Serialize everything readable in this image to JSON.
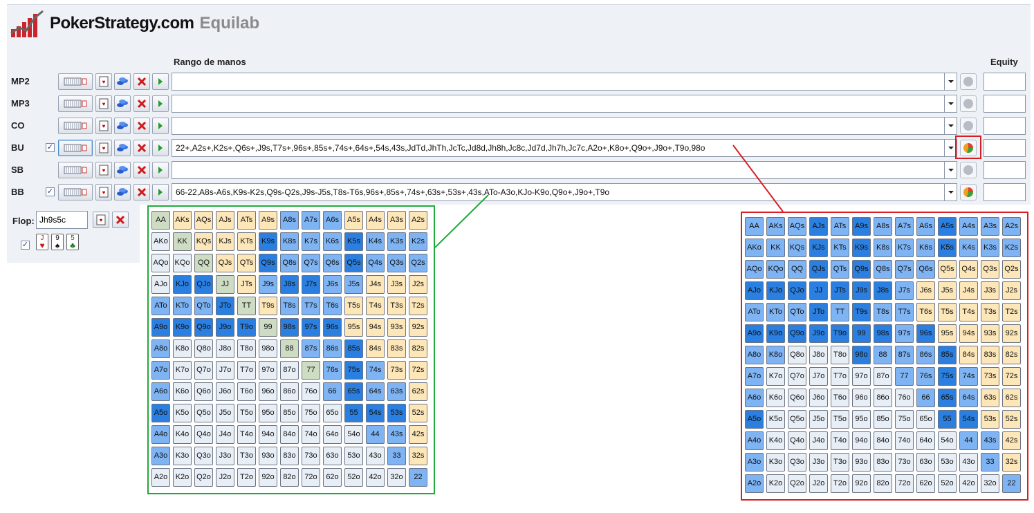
{
  "app": {
    "brand": "PokerStrategy.com",
    "product": "Equilab"
  },
  "headers": {
    "range": "Rango de manos",
    "equity": "Equity"
  },
  "rows": [
    {
      "label": "MP2",
      "checked": false,
      "range": "",
      "status": "idle"
    },
    {
      "label": "MP3",
      "checked": false,
      "range": "",
      "status": "idle"
    },
    {
      "label": "CO",
      "checked": false,
      "range": "",
      "status": "idle"
    },
    {
      "label": "BU",
      "checked": true,
      "range": "22+,A2s+,K2s+,Q6s+,J9s,T7s+,96s+,85s+,74s+,64s+,54s,43s,JdTd,JhTh,JcTc,Jd8d,Jh8h,Jc8c,Jd7d,Jh7h,Jc7c,A2o+,K8o+,Q9o+,J9o+,T9o,98o",
      "status": "active"
    },
    {
      "label": "SB",
      "checked": false,
      "range": "",
      "status": "idle"
    },
    {
      "label": "BB",
      "checked": true,
      "range": "66-22,A8s-A6s,K9s-K2s,Q9s-Q2s,J9s-J5s,T8s-T6s,96s+,85s+,74s+,63s+,53s+,43s,ATo-A3o,KJo-K9o,Q9o+,J9o+,T9o",
      "status": "active"
    }
  ],
  "flop": {
    "label": "Flop:",
    "value": "Jh9s5c",
    "cards": [
      {
        "rank": "J",
        "suit": "♥"
      },
      {
        "rank": "9",
        "suit": "♠"
      },
      {
        "rank": "5",
        "suit": "♣"
      }
    ]
  },
  "matrices": {
    "ranks": [
      "A",
      "K",
      "Q",
      "J",
      "T",
      "9",
      "8",
      "7",
      "6",
      "5",
      "4",
      "3",
      "2"
    ],
    "left_bb": [
      [
        2,
        1,
        1,
        1,
        1,
        1,
        3,
        3,
        3,
        1,
        1,
        1,
        1
      ],
      [
        0,
        2,
        1,
        1,
        1,
        4,
        3,
        3,
        3,
        4,
        3,
        3,
        3
      ],
      [
        0,
        0,
        2,
        1,
        1,
        4,
        3,
        3,
        3,
        4,
        3,
        3,
        3
      ],
      [
        0,
        4,
        4,
        2,
        1,
        3,
        4,
        4,
        3,
        3,
        1,
        1,
        1
      ],
      [
        3,
        3,
        3,
        4,
        2,
        1,
        3,
        3,
        3,
        1,
        1,
        1,
        1
      ],
      [
        4,
        4,
        4,
        4,
        4,
        2,
        4,
        4,
        4,
        1,
        1,
        1,
        1
      ],
      [
        3,
        0,
        0,
        0,
        0,
        0,
        2,
        3,
        3,
        4,
        1,
        1,
        1
      ],
      [
        3,
        0,
        0,
        0,
        0,
        0,
        0,
        2,
        3,
        4,
        3,
        1,
        1
      ],
      [
        3,
        0,
        0,
        0,
        0,
        0,
        0,
        0,
        3,
        4,
        3,
        3,
        1
      ],
      [
        4,
        0,
        0,
        0,
        0,
        0,
        0,
        0,
        0,
        4,
        4,
        4,
        1
      ],
      [
        3,
        0,
        0,
        0,
        0,
        0,
        0,
        0,
        0,
        0,
        3,
        3,
        1
      ],
      [
        3,
        0,
        0,
        0,
        0,
        0,
        0,
        0,
        0,
        0,
        0,
        3,
        1
      ],
      [
        0,
        0,
        0,
        0,
        0,
        0,
        0,
        0,
        0,
        0,
        0,
        0,
        3
      ]
    ],
    "right_bu": [
      [
        3,
        3,
        3,
        4,
        3,
        4,
        3,
        3,
        3,
        4,
        3,
        3,
        3
      ],
      [
        3,
        3,
        3,
        4,
        3,
        4,
        3,
        3,
        3,
        4,
        3,
        3,
        3
      ],
      [
        3,
        3,
        3,
        4,
        3,
        4,
        3,
        3,
        3,
        1,
        1,
        1,
        1
      ],
      [
        4,
        4,
        4,
        4,
        4,
        4,
        4,
        3,
        1,
        1,
        1,
        1,
        1
      ],
      [
        3,
        3,
        3,
        4,
        3,
        4,
        3,
        3,
        1,
        1,
        1,
        1,
        1
      ],
      [
        4,
        4,
        4,
        4,
        4,
        4,
        4,
        3,
        4,
        1,
        1,
        1,
        1
      ],
      [
        3,
        3,
        0,
        0,
        0,
        4,
        3,
        3,
        3,
        4,
        1,
        1,
        1
      ],
      [
        3,
        0,
        0,
        0,
        0,
        0,
        0,
        3,
        3,
        4,
        3,
        1,
        1
      ],
      [
        3,
        0,
        0,
        0,
        0,
        0,
        0,
        0,
        3,
        4,
        3,
        1,
        1
      ],
      [
        4,
        0,
        0,
        0,
        0,
        0,
        0,
        0,
        0,
        4,
        4,
        1,
        1
      ],
      [
        3,
        0,
        0,
        0,
        0,
        0,
        0,
        0,
        0,
        0,
        3,
        3,
        1
      ],
      [
        3,
        0,
        0,
        0,
        0,
        0,
        0,
        0,
        0,
        0,
        0,
        3,
        1
      ],
      [
        3,
        0,
        0,
        0,
        0,
        0,
        0,
        0,
        0,
        0,
        0,
        0,
        3
      ]
    ]
  }
}
